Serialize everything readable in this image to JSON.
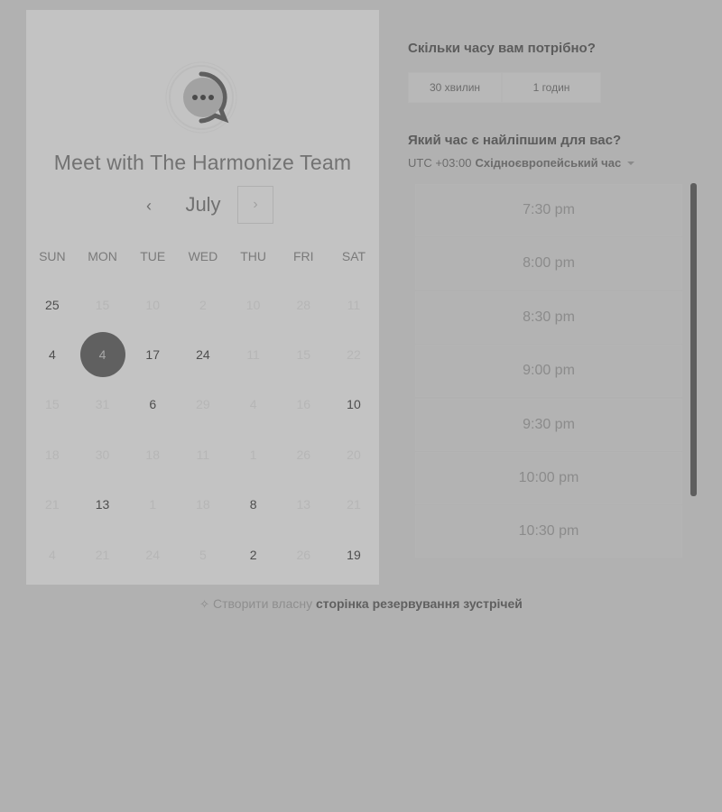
{
  "card": {
    "title": "Meet with The Harmonize Team",
    "logo_icon": "chat-bubble-dots-icon",
    "month": "July",
    "prev_icon": "‹",
    "next_icon": "›",
    "weekdays": [
      "SUN",
      "MON",
      "TUE",
      "WED",
      "THU",
      "FRI",
      "SAT"
    ],
    "weeks": [
      [
        {
          "d": "25",
          "s": "avail"
        },
        {
          "d": "15",
          "s": "dim"
        },
        {
          "d": "10",
          "s": "dim"
        },
        {
          "d": "2",
          "s": "dim"
        },
        {
          "d": "10",
          "s": "dim"
        },
        {
          "d": "28",
          "s": "dim"
        },
        {
          "d": "11",
          "s": "dim"
        }
      ],
      [
        {
          "d": "4",
          "s": "avail"
        },
        {
          "d": "4",
          "s": "selected"
        },
        {
          "d": "17",
          "s": "avail"
        },
        {
          "d": "24",
          "s": "avail"
        },
        {
          "d": "11",
          "s": "dim"
        },
        {
          "d": "15",
          "s": "dim"
        },
        {
          "d": "22",
          "s": "dim"
        }
      ],
      [
        {
          "d": "15",
          "s": "dim"
        },
        {
          "d": "31",
          "s": "dim"
        },
        {
          "d": "6",
          "s": "avail"
        },
        {
          "d": "29",
          "s": "dim"
        },
        {
          "d": "4",
          "s": "dim"
        },
        {
          "d": "16",
          "s": "dim"
        },
        {
          "d": "10",
          "s": "avail"
        }
      ],
      [
        {
          "d": "18",
          "s": "dim"
        },
        {
          "d": "30",
          "s": "dim"
        },
        {
          "d": "18",
          "s": "dim"
        },
        {
          "d": "11",
          "s": "dim"
        },
        {
          "d": "1",
          "s": "dim"
        },
        {
          "d": "26",
          "s": "dim"
        },
        {
          "d": "20",
          "s": "dim"
        }
      ],
      [
        {
          "d": "21",
          "s": "dim"
        },
        {
          "d": "13",
          "s": "avail"
        },
        {
          "d": "1",
          "s": "dim"
        },
        {
          "d": "18",
          "s": "dim"
        },
        {
          "d": "8",
          "s": "avail"
        },
        {
          "d": "13",
          "s": "dim"
        },
        {
          "d": "21",
          "s": "dim"
        }
      ],
      [
        {
          "d": "4",
          "s": "dim"
        },
        {
          "d": "21",
          "s": "dim"
        },
        {
          "d": "24",
          "s": "dim"
        },
        {
          "d": "5",
          "s": "dim"
        },
        {
          "d": "2",
          "s": "avail"
        },
        {
          "d": "26",
          "s": "dim"
        },
        {
          "d": "19",
          "s": "avail"
        }
      ]
    ]
  },
  "booking": {
    "duration_question": "Скільки часу вам потрібно?",
    "durations": [
      "30 хвилин",
      "1 годин"
    ],
    "time_question": "Який час є найліпшим для вас?",
    "timezone_offset": "UTC +03:00",
    "timezone_name": "Східноєвропейський час",
    "slots": [
      "7:30 pm",
      "8:00 pm",
      "8:30 pm",
      "9:00 pm",
      "9:30 pm",
      "10:00 pm",
      "10:30 pm"
    ]
  },
  "footer": {
    "icon": "sparkle-icon",
    "prefix": "Створити власну",
    "link": "сторінка резервування зустрічей"
  }
}
